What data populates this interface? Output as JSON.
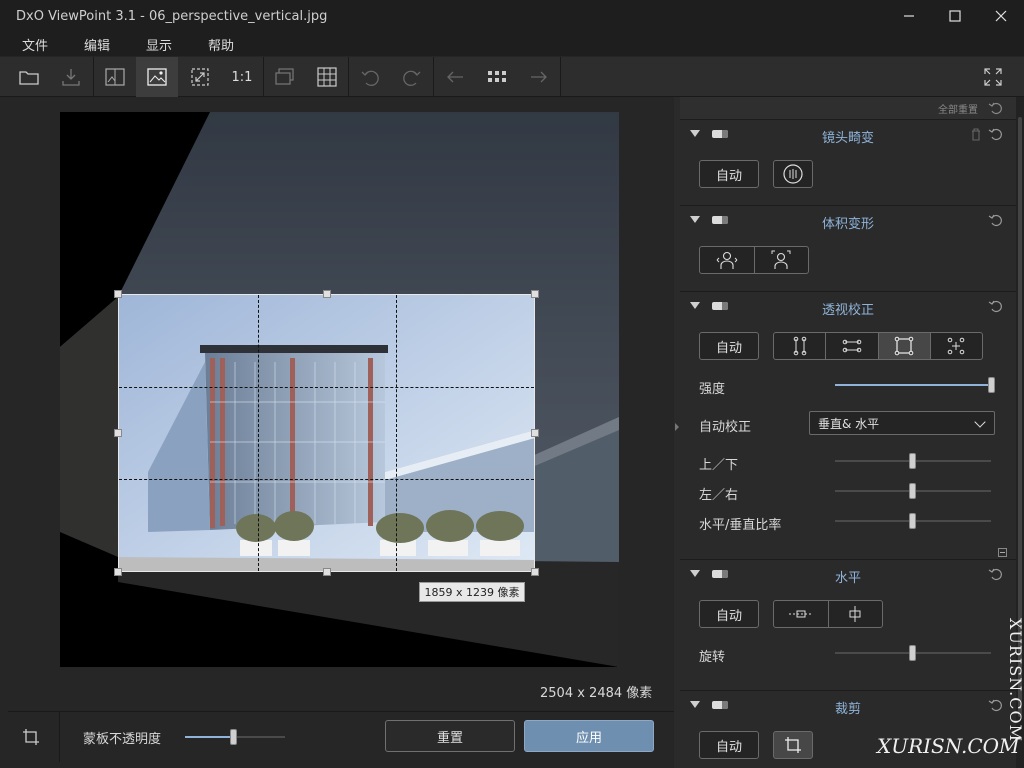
{
  "window": {
    "title": "DxO ViewPoint 3.1 - 06_perspective_vertical.jpg",
    "minimize": "—",
    "maximize": "☐",
    "close": "✕"
  },
  "menu": [
    "文件",
    "编辑",
    "显示",
    "帮助"
  ],
  "toolbar": {
    "one_to_one": "1:1"
  },
  "canvas": {
    "crop_size_label": "1859 x 1239 像素",
    "image_size": "2504 x 2484 像素"
  },
  "bottom": {
    "mask_opacity_label": "蒙板不透明度",
    "mask_opacity_value": 0.5,
    "reset_button": "重置",
    "apply_button": "应用"
  },
  "panel": {
    "reset_all": "全部重置",
    "sections": {
      "lens": {
        "title": "镜头畸变",
        "auto": "自动"
      },
      "volume": {
        "title": "体积变形"
      },
      "perspective": {
        "title": "透视校正",
        "auto": "自动",
        "intensity_label": "强度",
        "intensity_value": 1.0,
        "autocorrect_label": "自动校正",
        "autocorrect_value": "垂直& 水平",
        "up_down_label": "上／下",
        "up_down_value": 0.5,
        "left_right_label": "左／右",
        "left_right_value": 0.5,
        "ratio_label": "水平/垂直比率",
        "ratio_value": 0.5
      },
      "horizon": {
        "title": "水平",
        "auto": "自动",
        "rotation_label": "旋转",
        "rotation_value": 0.5
      },
      "crop": {
        "title": "裁剪",
        "auto": "自动"
      }
    }
  },
  "watermark": {
    "vertical": "XURISN.COM",
    "horizontal": "XURISN.COM"
  },
  "colors": {
    "accent": "#8fb3d9",
    "apply_button": "#6f8fb0",
    "panel": "#2a2a2a"
  }
}
